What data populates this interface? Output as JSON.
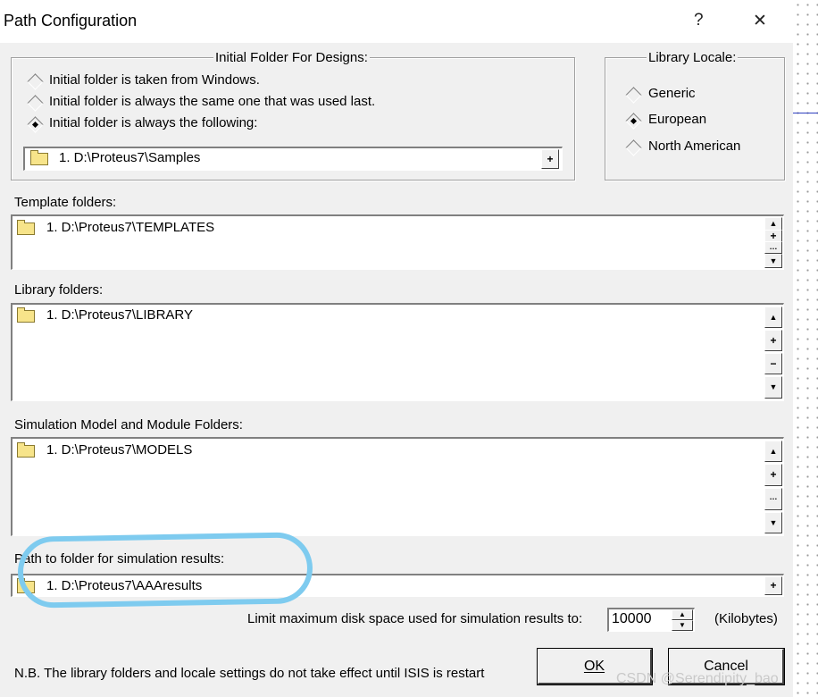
{
  "window": {
    "title": "Path Configuration",
    "help_glyph": "?",
    "close_glyph": "✕"
  },
  "initial_folder": {
    "group_title": "Initial Folder For Designs:",
    "options": [
      {
        "label": "Initial folder is taken from Windows.",
        "checked": false
      },
      {
        "label": "Initial folder is always the same one that was used last.",
        "checked": false
      },
      {
        "label": "Initial folder is always the following:",
        "checked": true
      }
    ],
    "path": "1.  D:\\Proteus7\\Samples"
  },
  "library_locale": {
    "group_title": "Library Locale:",
    "options": [
      {
        "label": "Generic",
        "checked": false
      },
      {
        "label": "European",
        "checked": true
      },
      {
        "label": "North American",
        "checked": false
      }
    ]
  },
  "template_folders": {
    "label": "Template folders:",
    "items": [
      "1.  D:\\Proteus7\\TEMPLATES"
    ]
  },
  "library_folders": {
    "label": "Library folders:",
    "items": [
      "1.  D:\\Proteus7\\LIBRARY"
    ]
  },
  "model_folders": {
    "label": "Simulation Model and Module Folders:",
    "items": [
      "1.  D:\\Proteus7\\MODELS"
    ]
  },
  "results_folder": {
    "label": "Path to folder for simulation results:",
    "path": "1.  D:\\Proteus7\\AAAresults"
  },
  "disk_limit": {
    "label": "Limit maximum disk space used for simulation results to:",
    "value": "10000",
    "unit": "(Kilobytes)"
  },
  "note": "N.B. The library folders and locale settings do not take effect until ISIS is restart",
  "buttons": {
    "ok": "OK",
    "cancel": "Cancel"
  },
  "glyphs": {
    "up": "▲",
    "down": "▼",
    "plus": "+",
    "minus": "−",
    "edit": "…"
  },
  "watermark": "CSDN @Serendipity_bao",
  "colors": {
    "highlight": "#7ecbef",
    "folder": "#f7e48a"
  }
}
